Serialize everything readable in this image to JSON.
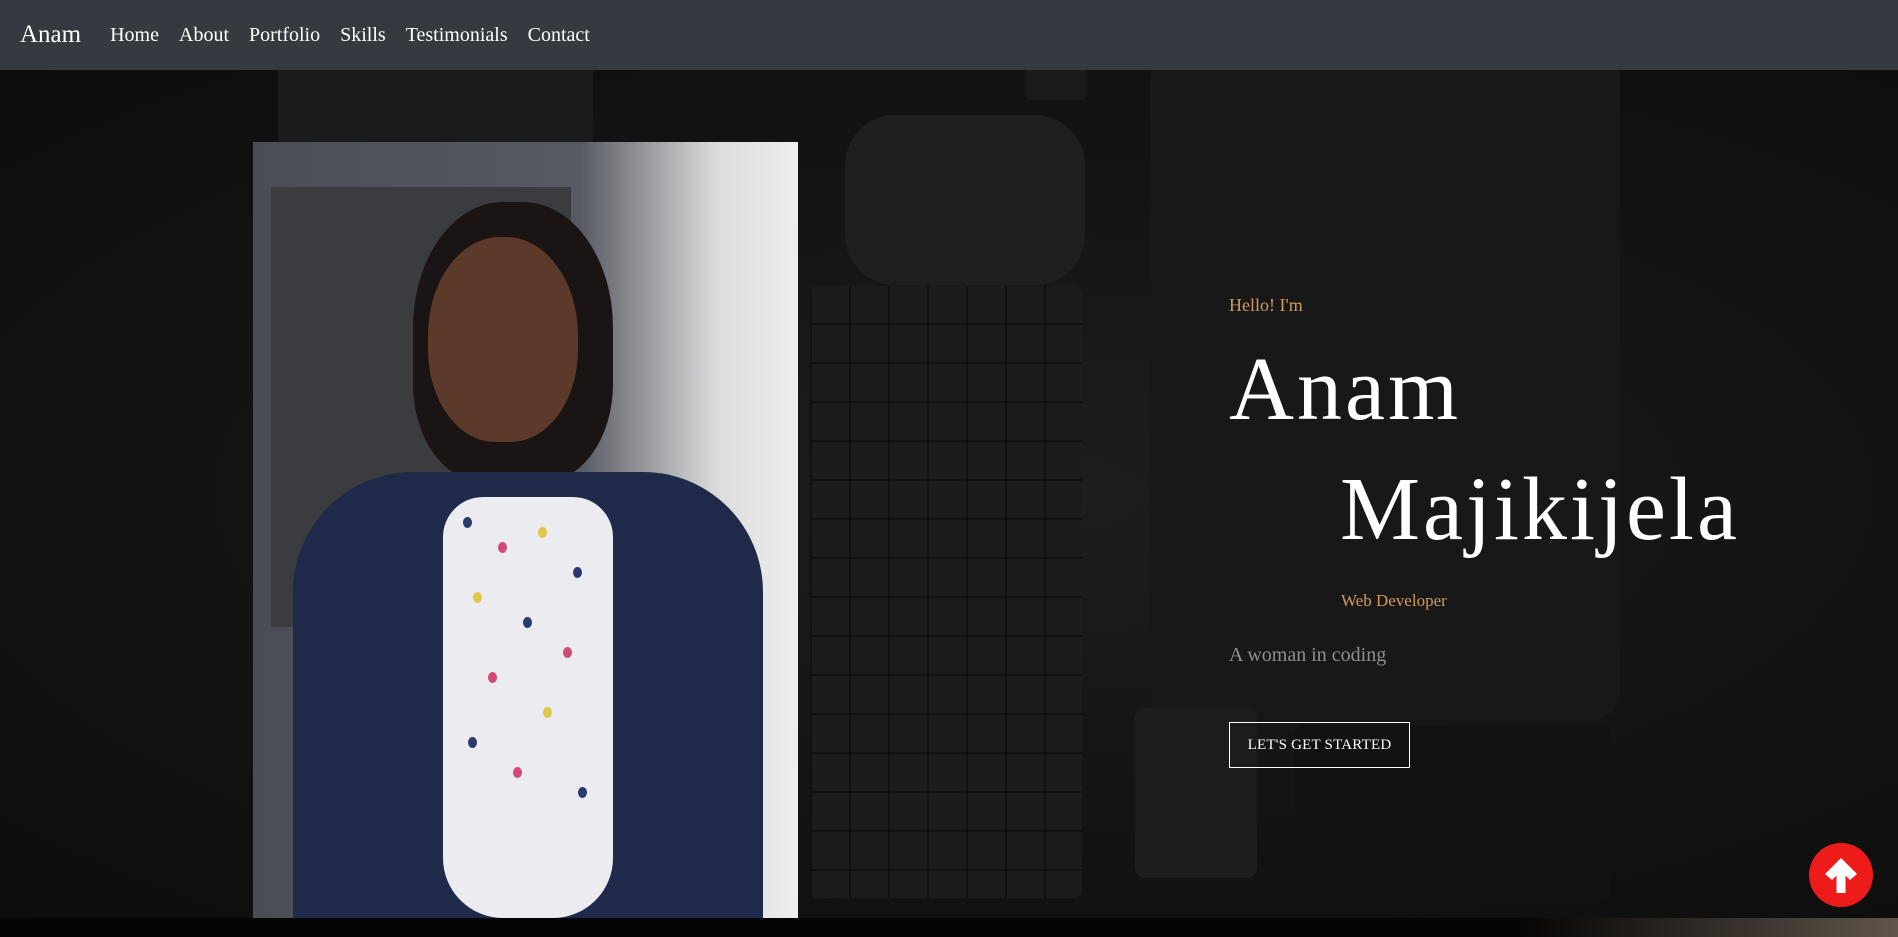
{
  "navbar": {
    "brand": "Anam",
    "links": [
      "Home",
      "About",
      "Portfolio",
      "Skills",
      "Testimonials",
      "Contact"
    ]
  },
  "hero": {
    "greeting": "Hello! I'm",
    "first_name": "Anam",
    "last_name": "Majikijela",
    "role": "Web Developer",
    "tagline": "A woman in coding",
    "cta_label": "LET'S GET STARTED"
  },
  "icons": {
    "scroll_top": "arrow-up-circle-icon"
  },
  "colors": {
    "navbar_bg": "#343a40",
    "accent": "#d39a5c",
    "scroll_button": "#ee1b1b"
  }
}
